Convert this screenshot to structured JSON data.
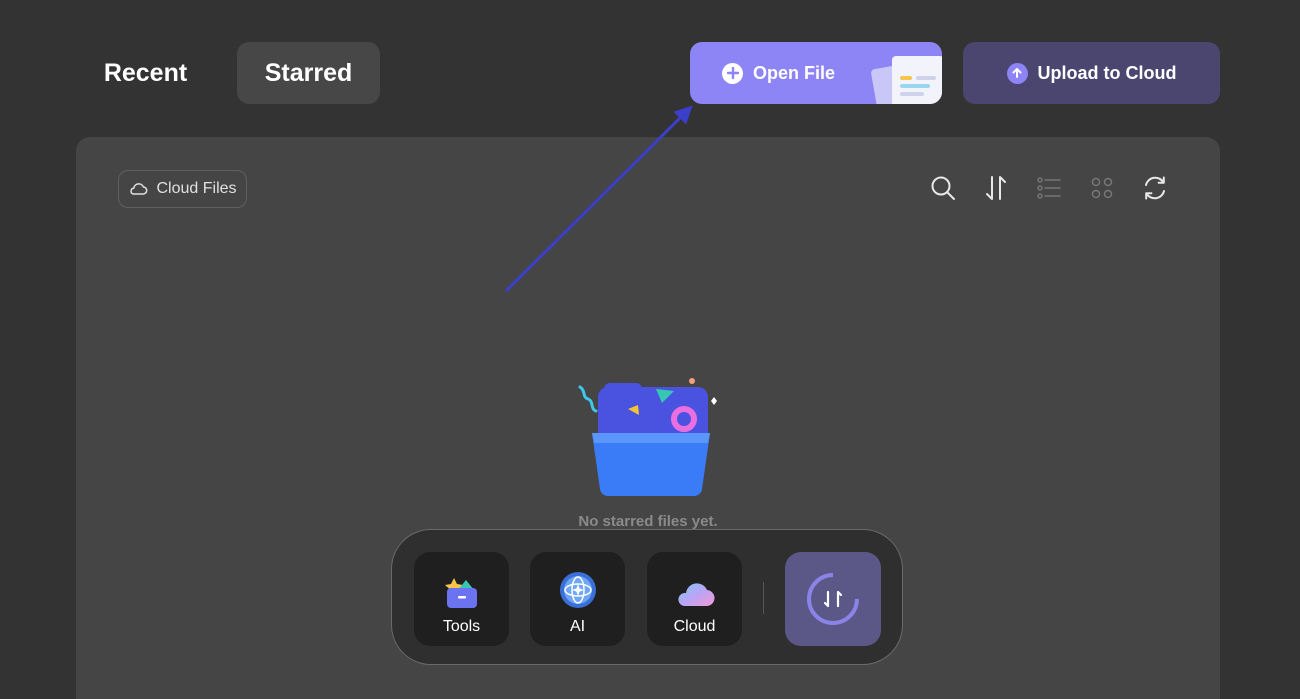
{
  "tabs": [
    {
      "label": "Recent"
    },
    {
      "label": "Starred",
      "active": true
    }
  ],
  "buttons": {
    "open_file": "Open File",
    "upload_cloud": "Upload to Cloud"
  },
  "panel": {
    "cloud_files_label": "Cloud Files",
    "toolbar_icons": [
      "search-icon",
      "sort-icon",
      "list-view-icon",
      "grid-view-icon",
      "refresh-icon"
    ],
    "empty_message": "No starred files yet."
  },
  "dock": {
    "items": [
      {
        "label": "Tools",
        "icon": "tools-icon"
      },
      {
        "label": "AI",
        "icon": "ai-icon"
      },
      {
        "label": "Cloud",
        "icon": "cloud-icon"
      }
    ],
    "transfer_icon": "transfer-icon"
  },
  "colors": {
    "background": "#333333",
    "panel": "#454545",
    "accent": "#8d84f5",
    "upload_button": "#4a4670",
    "annotation_arrow": "#3b3fc9"
  }
}
